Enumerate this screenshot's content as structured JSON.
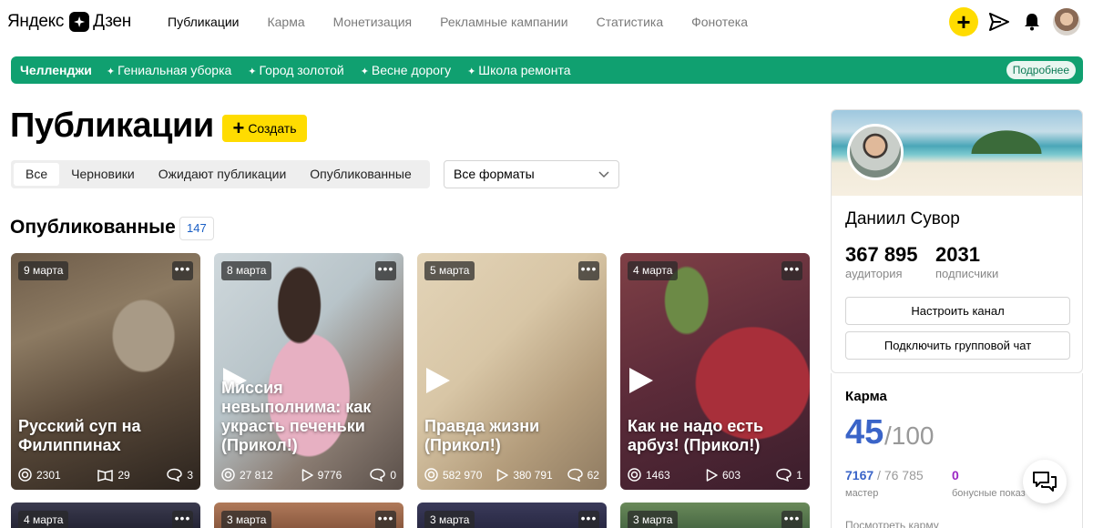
{
  "header": {
    "logo_left": "Яндекс",
    "logo_right": "Дзен",
    "nav": [
      "Публикации",
      "Карма",
      "Монетизация",
      "Рекламные кампании",
      "Статистика",
      "Фонотека"
    ],
    "active_nav": "Публикации",
    "icons": [
      "plus-icon",
      "send-icon",
      "bell-icon",
      "user-avatar"
    ]
  },
  "challenge": {
    "title": "Челленджи",
    "items": [
      "Гениальная уборка",
      "Город золотой",
      "Весне дорогу",
      "Школа ремонта"
    ],
    "more": "Подробнее"
  },
  "main": {
    "title": "Публикации",
    "create_label": "Создать",
    "tabs": [
      "Все",
      "Черновики",
      "Ожидают публикации",
      "Опубликованные"
    ],
    "active_tab": "Все",
    "format_select": "Все форматы",
    "section_title": "Опубликованные",
    "section_count": "147"
  },
  "cards": [
    {
      "date": "9 марта",
      "title": "Русский суп на Филиппинах",
      "video": false,
      "views": "2301",
      "reads": "29",
      "comments": "3"
    },
    {
      "date": "8 марта",
      "title": "Миссия невыполнима: как украсть печеньки (Прикол!)",
      "video": true,
      "views": "27 812",
      "reads": "9776",
      "comments": "0"
    },
    {
      "date": "5 марта",
      "title": "Правда жизни (Прикол!)",
      "video": true,
      "views": "582 970",
      "reads": "380 791",
      "comments": "62"
    },
    {
      "date": "4 марта",
      "title": "Как не надо есть арбуз! (Прикол!)",
      "video": true,
      "views": "1463",
      "reads": "603",
      "comments": "1"
    }
  ],
  "cards_bottom": [
    {
      "date": "4 марта"
    },
    {
      "date": "3 марта"
    },
    {
      "date": "3 марта"
    },
    {
      "date": "3 марта"
    }
  ],
  "profile": {
    "name": "Даниил Сувор",
    "audience": "367 895",
    "audience_label": "аудитория",
    "subscribers": "2031",
    "subscribers_label": "подписчики",
    "setup_button": "Настроить канал",
    "chat_button": "Подключить групповой чат"
  },
  "karma": {
    "title": "Карма",
    "score": "45",
    "max": "/100",
    "master_value": "7167",
    "master_total": " / 76 785",
    "master_label": "мастер",
    "bonus_value": "0",
    "bonus_label": "бонусные показ",
    "more": "Посмотреть карму"
  }
}
